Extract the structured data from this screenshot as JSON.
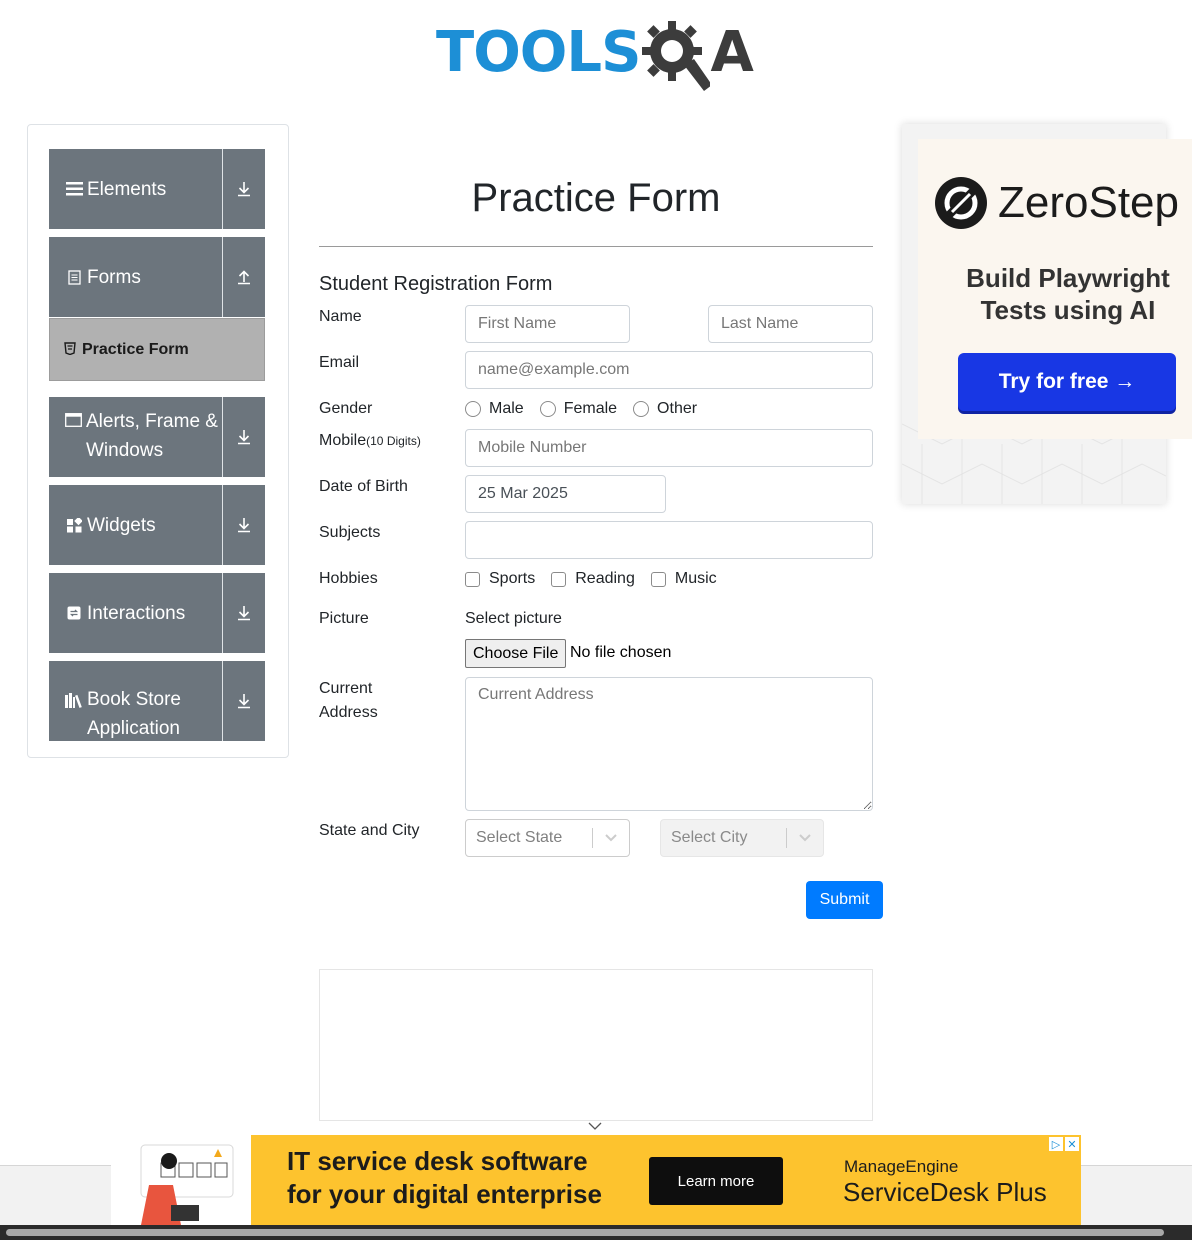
{
  "logo": {
    "text": "TOOLS",
    "qa": "A"
  },
  "sidebar": {
    "groups": [
      {
        "label": "Elements",
        "icon": "menu-icon",
        "expanded": false
      },
      {
        "label": "Forms",
        "icon": "document-icon",
        "expanded": true
      },
      {
        "label": "Alerts, Frame & Windows",
        "icon": "window-icon",
        "expanded": false
      },
      {
        "label": "Widgets",
        "icon": "widgets-icon",
        "expanded": false
      },
      {
        "label": "Interactions",
        "icon": "interactions-icon",
        "expanded": false
      },
      {
        "label": "Book Store Application",
        "icon": "books-icon",
        "expanded": false
      }
    ],
    "active_item": "Practice Form"
  },
  "main": {
    "page_title": "Practice Form",
    "form_title": "Student Registration Form",
    "labels": {
      "name": "Name",
      "email": "Email",
      "gender": "Gender",
      "mobile": "Mobile",
      "mobile_hint": "(10 Digits)",
      "dob": "Date of Birth",
      "subjects": "Subjects",
      "hobbies": "Hobbies",
      "picture": "Picture",
      "current_address_1": "Current",
      "current_address_2": "Address",
      "state_city": "State and City"
    },
    "placeholders": {
      "first_name": "First Name",
      "last_name": "Last Name",
      "email": "name@example.com",
      "mobile": "Mobile Number",
      "current_address": "Current Address"
    },
    "values": {
      "dob": "25 Mar 2025",
      "subjects": ""
    },
    "gender_options": [
      "Male",
      "Female",
      "Other"
    ],
    "hobby_options": [
      "Sports",
      "Reading",
      "Music"
    ],
    "picture": {
      "select_label": "Select picture",
      "button": "Choose File",
      "status": "No file chosen"
    },
    "state_select": "Select State",
    "city_select": "Select City",
    "submit": "Submit"
  },
  "right_ad": {
    "brand": "ZeroStep",
    "tagline_1": "Build Playwright",
    "tagline_2": "Tests using AI",
    "cta": "Try for free →"
  },
  "bottom_ad": {
    "headline_1": "IT service desk software",
    "headline_2": "for your digital enterprise",
    "cta": "Learn more",
    "brand_1": "ManageEngine",
    "brand_2": "ServiceDesk Plus"
  },
  "colors": {
    "brand_blue": "#1d8fd6",
    "sidebar_bg": "#6c757d",
    "submit_bg": "#007bff",
    "ad_yellow": "#fdc32e",
    "zerostep_btn": "#1837e4"
  }
}
